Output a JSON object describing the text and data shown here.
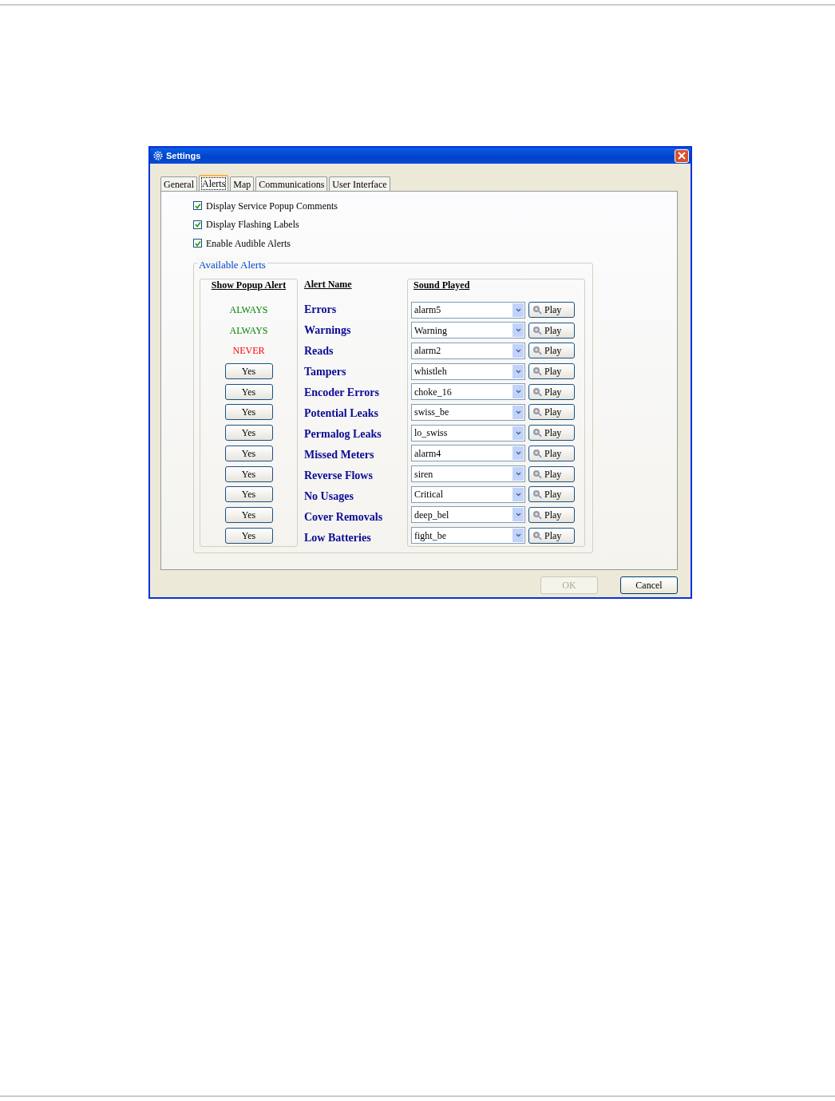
{
  "window": {
    "title": "Settings"
  },
  "tabs": [
    {
      "label": "General",
      "selected": false
    },
    {
      "label": "Alerts",
      "selected": true
    },
    {
      "label": "Map",
      "selected": false
    },
    {
      "label": "Communications",
      "selected": false
    },
    {
      "label": "User Interface",
      "selected": false
    }
  ],
  "options": [
    {
      "label": "Display Service Popup Comments",
      "checked": true
    },
    {
      "label": "Display Flashing Labels",
      "checked": true
    },
    {
      "label": "Enable Audible Alerts",
      "checked": true
    }
  ],
  "available_alerts": {
    "title": "Available Alerts",
    "columns": [
      "Show Popup Alert",
      "Alert Name",
      "Sound Played"
    ],
    "rows": [
      {
        "popup": {
          "kind": "text",
          "text": "ALWAYS",
          "color": "#008000"
        },
        "name": "Errors",
        "sound": "alarm5",
        "play": "Play"
      },
      {
        "popup": {
          "kind": "text",
          "text": "ALWAYS",
          "color": "#008000"
        },
        "name": "Warnings",
        "sound": "Warning",
        "play": "Play"
      },
      {
        "popup": {
          "kind": "text",
          "text": "NEVER",
          "color": "#ff0000"
        },
        "name": "Reads",
        "sound": "alarm2",
        "play": "Play"
      },
      {
        "popup": {
          "kind": "button",
          "text": "Yes"
        },
        "name": "Tampers",
        "sound": "whistleh",
        "play": "Play"
      },
      {
        "popup": {
          "kind": "button",
          "text": "Yes"
        },
        "name": "Encoder Errors",
        "sound": "choke_16",
        "play": "Play"
      },
      {
        "popup": {
          "kind": "button",
          "text": "Yes"
        },
        "name": "Potential Leaks",
        "sound": "swiss_be",
        "play": "Play"
      },
      {
        "popup": {
          "kind": "button",
          "text": "Yes"
        },
        "name": "Permalog Leaks",
        "sound": "lo_swiss",
        "play": "Play"
      },
      {
        "popup": {
          "kind": "button",
          "text": "Yes"
        },
        "name": "Missed Meters",
        "sound": "alarm4",
        "play": "Play"
      },
      {
        "popup": {
          "kind": "button",
          "text": "Yes"
        },
        "name": "Reverse Flows",
        "sound": "siren",
        "play": "Play"
      },
      {
        "popup": {
          "kind": "button",
          "text": "Yes"
        },
        "name": "No Usages",
        "sound": "Critical",
        "play": "Play"
      },
      {
        "popup": {
          "kind": "button",
          "text": "Yes"
        },
        "name": "Cover Removals",
        "sound": "deep_bel",
        "play": "Play"
      },
      {
        "popup": {
          "kind": "button",
          "text": "Yes"
        },
        "name": "Low Batteries",
        "sound": "fight_be",
        "play": "Play"
      }
    ]
  },
  "buttons": [
    {
      "label": "OK",
      "disabled": true
    },
    {
      "label": "Cancel",
      "disabled": false
    }
  ]
}
